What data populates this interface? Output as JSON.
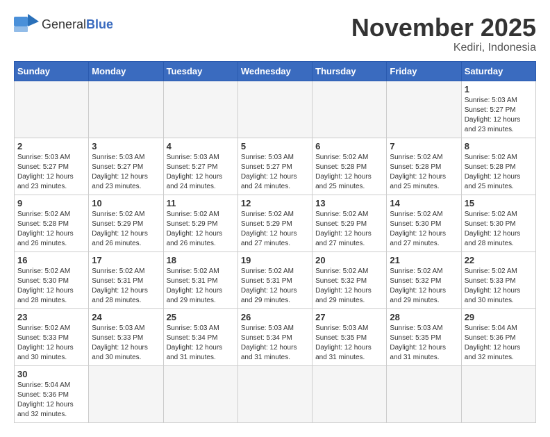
{
  "header": {
    "title": "November 2025",
    "subtitle": "Kediri, Indonesia",
    "logo_general": "General",
    "logo_blue": "Blue"
  },
  "weekdays": [
    "Sunday",
    "Monday",
    "Tuesday",
    "Wednesday",
    "Thursday",
    "Friday",
    "Saturday"
  ],
  "weeks": [
    [
      {
        "day": "",
        "info": ""
      },
      {
        "day": "",
        "info": ""
      },
      {
        "day": "",
        "info": ""
      },
      {
        "day": "",
        "info": ""
      },
      {
        "day": "",
        "info": ""
      },
      {
        "day": "",
        "info": ""
      },
      {
        "day": "1",
        "info": "Sunrise: 5:03 AM\nSunset: 5:27 PM\nDaylight: 12 hours\nand 23 minutes."
      }
    ],
    [
      {
        "day": "2",
        "info": "Sunrise: 5:03 AM\nSunset: 5:27 PM\nDaylight: 12 hours\nand 23 minutes."
      },
      {
        "day": "3",
        "info": "Sunrise: 5:03 AM\nSunset: 5:27 PM\nDaylight: 12 hours\nand 23 minutes."
      },
      {
        "day": "4",
        "info": "Sunrise: 5:03 AM\nSunset: 5:27 PM\nDaylight: 12 hours\nand 24 minutes."
      },
      {
        "day": "5",
        "info": "Sunrise: 5:03 AM\nSunset: 5:27 PM\nDaylight: 12 hours\nand 24 minutes."
      },
      {
        "day": "6",
        "info": "Sunrise: 5:02 AM\nSunset: 5:28 PM\nDaylight: 12 hours\nand 25 minutes."
      },
      {
        "day": "7",
        "info": "Sunrise: 5:02 AM\nSunset: 5:28 PM\nDaylight: 12 hours\nand 25 minutes."
      },
      {
        "day": "8",
        "info": "Sunrise: 5:02 AM\nSunset: 5:28 PM\nDaylight: 12 hours\nand 25 minutes."
      }
    ],
    [
      {
        "day": "9",
        "info": "Sunrise: 5:02 AM\nSunset: 5:28 PM\nDaylight: 12 hours\nand 26 minutes."
      },
      {
        "day": "10",
        "info": "Sunrise: 5:02 AM\nSunset: 5:29 PM\nDaylight: 12 hours\nand 26 minutes."
      },
      {
        "day": "11",
        "info": "Sunrise: 5:02 AM\nSunset: 5:29 PM\nDaylight: 12 hours\nand 26 minutes."
      },
      {
        "day": "12",
        "info": "Sunrise: 5:02 AM\nSunset: 5:29 PM\nDaylight: 12 hours\nand 27 minutes."
      },
      {
        "day": "13",
        "info": "Sunrise: 5:02 AM\nSunset: 5:29 PM\nDaylight: 12 hours\nand 27 minutes."
      },
      {
        "day": "14",
        "info": "Sunrise: 5:02 AM\nSunset: 5:30 PM\nDaylight: 12 hours\nand 27 minutes."
      },
      {
        "day": "15",
        "info": "Sunrise: 5:02 AM\nSunset: 5:30 PM\nDaylight: 12 hours\nand 28 minutes."
      }
    ],
    [
      {
        "day": "16",
        "info": "Sunrise: 5:02 AM\nSunset: 5:30 PM\nDaylight: 12 hours\nand 28 minutes."
      },
      {
        "day": "17",
        "info": "Sunrise: 5:02 AM\nSunset: 5:31 PM\nDaylight: 12 hours\nand 28 minutes."
      },
      {
        "day": "18",
        "info": "Sunrise: 5:02 AM\nSunset: 5:31 PM\nDaylight: 12 hours\nand 29 minutes."
      },
      {
        "day": "19",
        "info": "Sunrise: 5:02 AM\nSunset: 5:31 PM\nDaylight: 12 hours\nand 29 minutes."
      },
      {
        "day": "20",
        "info": "Sunrise: 5:02 AM\nSunset: 5:32 PM\nDaylight: 12 hours\nand 29 minutes."
      },
      {
        "day": "21",
        "info": "Sunrise: 5:02 AM\nSunset: 5:32 PM\nDaylight: 12 hours\nand 29 minutes."
      },
      {
        "day": "22",
        "info": "Sunrise: 5:02 AM\nSunset: 5:33 PM\nDaylight: 12 hours\nand 30 minutes."
      }
    ],
    [
      {
        "day": "23",
        "info": "Sunrise: 5:02 AM\nSunset: 5:33 PM\nDaylight: 12 hours\nand 30 minutes."
      },
      {
        "day": "24",
        "info": "Sunrise: 5:03 AM\nSunset: 5:33 PM\nDaylight: 12 hours\nand 30 minutes."
      },
      {
        "day": "25",
        "info": "Sunrise: 5:03 AM\nSunset: 5:34 PM\nDaylight: 12 hours\nand 31 minutes."
      },
      {
        "day": "26",
        "info": "Sunrise: 5:03 AM\nSunset: 5:34 PM\nDaylight: 12 hours\nand 31 minutes."
      },
      {
        "day": "27",
        "info": "Sunrise: 5:03 AM\nSunset: 5:35 PM\nDaylight: 12 hours\nand 31 minutes."
      },
      {
        "day": "28",
        "info": "Sunrise: 5:03 AM\nSunset: 5:35 PM\nDaylight: 12 hours\nand 31 minutes."
      },
      {
        "day": "29",
        "info": "Sunrise: 5:04 AM\nSunset: 5:36 PM\nDaylight: 12 hours\nand 32 minutes."
      }
    ],
    [
      {
        "day": "30",
        "info": "Sunrise: 5:04 AM\nSunset: 5:36 PM\nDaylight: 12 hours\nand 32 minutes."
      },
      {
        "day": "",
        "info": ""
      },
      {
        "day": "",
        "info": ""
      },
      {
        "day": "",
        "info": ""
      },
      {
        "day": "",
        "info": ""
      },
      {
        "day": "",
        "info": ""
      },
      {
        "day": "",
        "info": ""
      }
    ]
  ]
}
